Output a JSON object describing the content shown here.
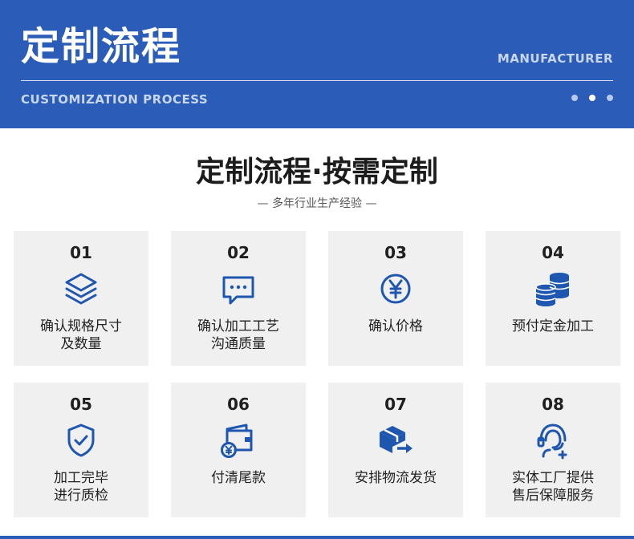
{
  "banner": {
    "title": "定制流程",
    "right_label": "MANUFACTURER",
    "subtitle": "CUSTOMIZATION PROCESS",
    "dots": [
      false,
      true,
      false
    ]
  },
  "heading": {
    "title": "定制流程·按需定制",
    "subtitle": "— 多年行业生产经验 —"
  },
  "steps": [
    {
      "num": "01",
      "icon": "layers-icon",
      "lines": [
        "确认规格尺寸",
        "及数量"
      ]
    },
    {
      "num": "02",
      "icon": "chat-bubble-icon",
      "lines": [
        "确认加工工艺",
        "沟通质量"
      ]
    },
    {
      "num": "03",
      "icon": "yuan-coin-icon",
      "lines": [
        "确认价格",
        ""
      ]
    },
    {
      "num": "04",
      "icon": "coin-stack-icon",
      "lines": [
        "预付定金加工",
        ""
      ]
    },
    {
      "num": "05",
      "icon": "shield-check-icon",
      "lines": [
        "加工完毕",
        "进行质检"
      ]
    },
    {
      "num": "06",
      "icon": "wallet-icon",
      "lines": [
        "付清尾款",
        ""
      ]
    },
    {
      "num": "07",
      "icon": "delivery-box-icon",
      "lines": [
        "安排物流发货",
        ""
      ]
    },
    {
      "num": "08",
      "icon": "customer-service-icon",
      "lines": [
        "实体工厂提供",
        "售后保障服务"
      ]
    }
  ],
  "colors": {
    "brand": "#2a5cb8",
    "icon": "#1e56b0",
    "card": "#f0f0f0"
  }
}
